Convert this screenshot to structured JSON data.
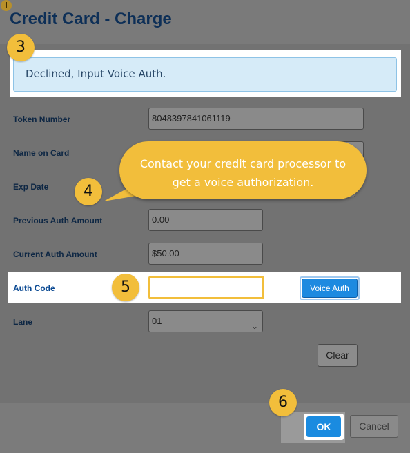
{
  "dialog": {
    "title": "Credit Card - Charge",
    "info_icon": "info-icon"
  },
  "alert": {
    "message": "Declined, Input Voice Auth."
  },
  "form": {
    "token_number": {
      "label": "Token Number",
      "value": "8048397841061119"
    },
    "name_on_card": {
      "label": "Name on Card",
      "value": ""
    },
    "exp_date": {
      "label": "Exp Date",
      "value": ""
    },
    "previous_auth_amount": {
      "label": "Previous Auth Amount",
      "value": "0.00"
    },
    "current_auth_amount": {
      "label": "Current Auth Amount",
      "value": "$50.00"
    },
    "auth_code": {
      "label": "Auth Code",
      "value": ""
    },
    "lane": {
      "label": "Lane",
      "value": "01"
    }
  },
  "buttons": {
    "voice_auth": "Voice Auth",
    "clear": "Clear",
    "ok": "OK",
    "cancel": "Cancel"
  },
  "callout": {
    "line1": "Contact your credit card processor to",
    "line2": "get a voice authorization."
  },
  "steps": {
    "s3": "3",
    "s4": "4",
    "s5": "5",
    "s6": "6"
  },
  "colors": {
    "accent": "#f2be3b",
    "primary_button": "#1a8be0",
    "title": "#0d2f57"
  }
}
